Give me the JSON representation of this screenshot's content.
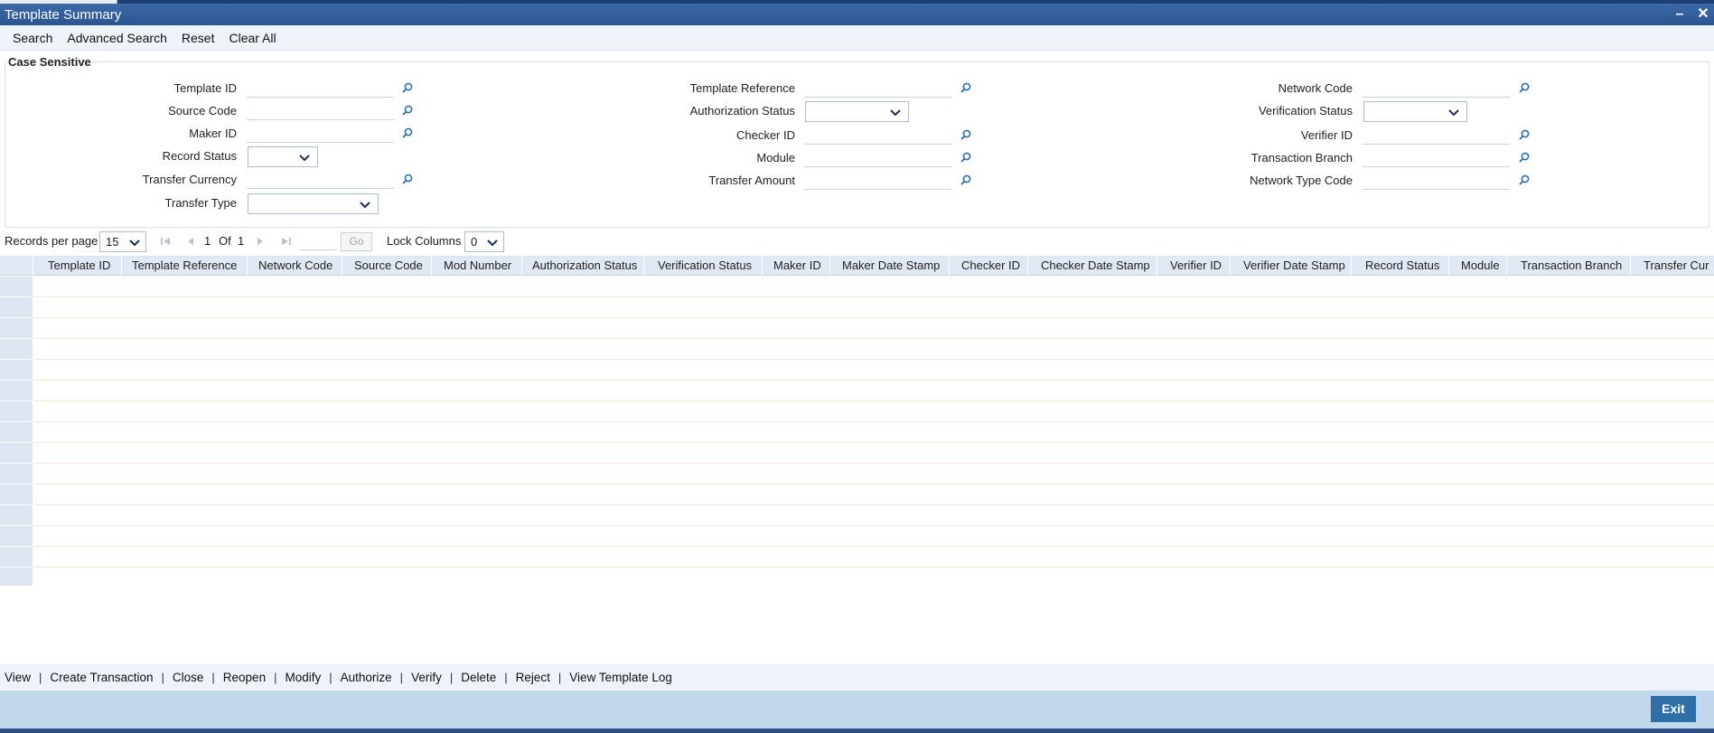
{
  "window": {
    "title": "Template Summary",
    "minimize_icon": "minimize-icon",
    "close_icon": "close-icon"
  },
  "toolbar": {
    "search": "Search",
    "advanced_search": "Advanced Search",
    "reset": "Reset",
    "clear_all": "Clear All"
  },
  "criteria": {
    "legend": "Case Sensitive",
    "fields": {
      "template_id": "Template ID",
      "source_code": "Source Code",
      "maker_id": "Maker ID",
      "record_status": "Record Status",
      "transfer_currency": "Transfer Currency",
      "transfer_type": "Transfer Type",
      "template_reference": "Template Reference",
      "authorization_status": "Authorization Status",
      "checker_id": "Checker ID",
      "module": "Module",
      "transfer_amount": "Transfer Amount",
      "network_code": "Network Code",
      "verification_status": "Verification Status",
      "verifier_id": "Verifier ID",
      "transaction_branch": "Transaction Branch",
      "network_type_code": "Network Type Code"
    }
  },
  "pager": {
    "records_per_page_label": "Records per page",
    "records_per_page": "15",
    "current_page": "1",
    "of_label": "Of",
    "total_pages": "1",
    "go_label": "Go",
    "lock_columns_label": "Lock Columns",
    "lock_columns": "0"
  },
  "grid": {
    "columns": [
      "Template ID",
      "Template Reference",
      "Network Code",
      "Source Code",
      "Mod Number",
      "Authorization Status",
      "Verification Status",
      "Maker ID",
      "Maker Date Stamp",
      "Checker ID",
      "Checker Date Stamp",
      "Verifier ID",
      "Verifier Date Stamp",
      "Record Status",
      "Module",
      "Transaction Branch",
      "Transfer Cur"
    ]
  },
  "actions": {
    "view": "View",
    "create_transaction": "Create Transaction",
    "close": "Close",
    "reopen": "Reopen",
    "modify": "Modify",
    "authorize": "Authorize",
    "verify": "Verify",
    "delete": "Delete",
    "reject": "Reject",
    "view_template_log": "View Template Log",
    "separator": "|"
  },
  "footer": {
    "exit": "Exit"
  },
  "colors": {
    "titlebar": "#2a5591",
    "footer": "#c2d8ec",
    "exit_button": "#2e6fa7",
    "grid_header": "#dfe8f3"
  }
}
